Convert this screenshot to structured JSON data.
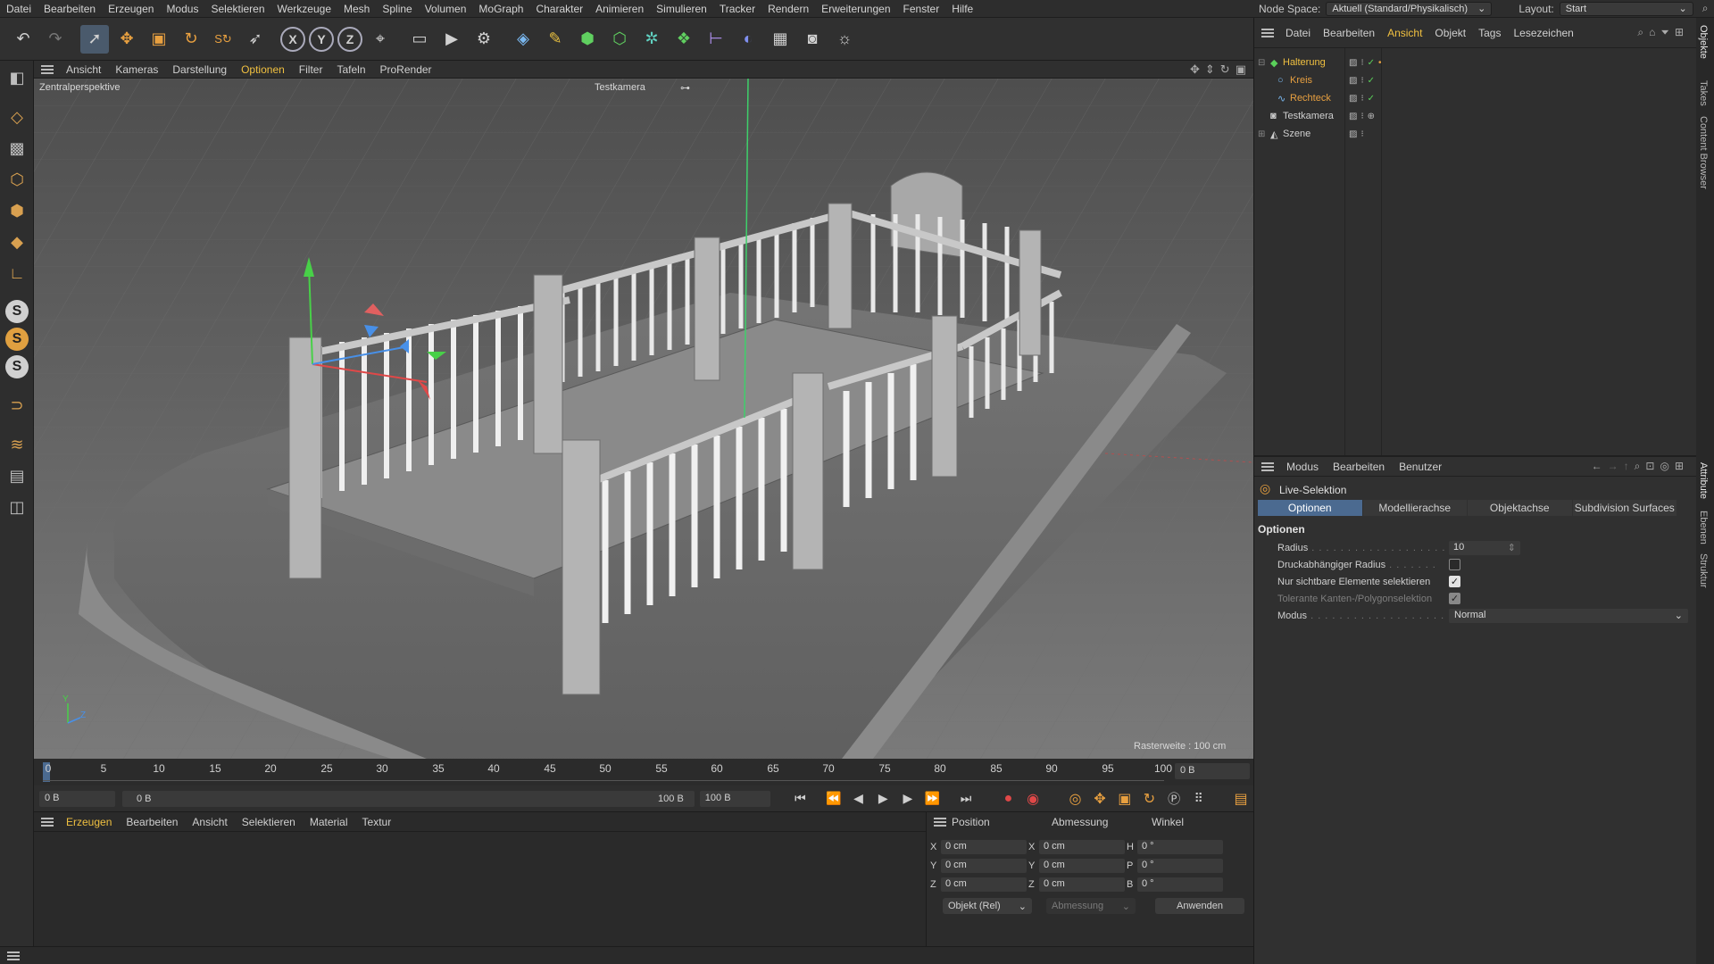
{
  "menubar": {
    "items": [
      "Datei",
      "Bearbeiten",
      "Erzeugen",
      "Modus",
      "Selektieren",
      "Werkzeuge",
      "Mesh",
      "Spline",
      "Volumen",
      "MoGraph",
      "Charakter",
      "Animieren",
      "Simulieren",
      "Tracker",
      "Rendern",
      "Erweiterungen",
      "Fenster",
      "Hilfe"
    ]
  },
  "topright": {
    "node_space_label": "Node Space:",
    "node_space_value": "Aktuell (Standard/Physikalisch)",
    "layout_label": "Layout:",
    "layout_value": "Start"
  },
  "viewport": {
    "menu": [
      "Ansicht",
      "Kameras",
      "Darstellung",
      "Optionen",
      "Filter",
      "Tafeln",
      "ProRender"
    ],
    "active_menu": "Optionen",
    "perspective_label": "Zentralperspektive",
    "camera_label": "Testkamera",
    "grid_label": "Rasterweite : 100 cm",
    "axis_y": "Y",
    "axis_z": "Z"
  },
  "timeline": {
    "ticks": [
      "0",
      "5",
      "10",
      "15",
      "20",
      "25",
      "30",
      "35",
      "40",
      "45",
      "50",
      "55",
      "60",
      "65",
      "70",
      "75",
      "80",
      "85",
      "90",
      "95",
      "100"
    ],
    "current": "0 B",
    "end_field": "0 B"
  },
  "transport": {
    "start_field": "0 B",
    "range_start": "0 B",
    "range_end": "100 B",
    "end_field": "100 B"
  },
  "material_menu": {
    "items": [
      "Erzeugen",
      "Bearbeiten",
      "Ansicht",
      "Selektieren",
      "Material",
      "Textur"
    ],
    "active": "Erzeugen"
  },
  "coords": {
    "headers": [
      "Position",
      "Abmessung",
      "Winkel"
    ],
    "rows": [
      {
        "pos_axis": "X",
        "pos": "0 cm",
        "size_axis": "X",
        "size": "0 cm",
        "rot_axis": "H",
        "rot": "0 °"
      },
      {
        "pos_axis": "Y",
        "pos": "0 cm",
        "size_axis": "Y",
        "size": "0 cm",
        "rot_axis": "P",
        "rot": "0 °"
      },
      {
        "pos_axis": "Z",
        "pos": "0 cm",
        "size_axis": "Z",
        "size": "0 cm",
        "rot_axis": "B",
        "rot": "0 °"
      }
    ],
    "mode_select": "Objekt (Rel)",
    "size_select": "Abmessung",
    "apply_button": "Anwenden"
  },
  "objects": {
    "menu": [
      "Datei",
      "Bearbeiten",
      "Ansicht",
      "Objekt",
      "Tags",
      "Lesezeichen"
    ],
    "active_menu": "Ansicht",
    "items": [
      {
        "name": "Halterung",
        "color": "#f0c040"
      },
      {
        "name": "Kreis",
        "color": "#e8a040"
      },
      {
        "name": "Rechteck",
        "color": "#e8a040"
      },
      {
        "name": "Testkamera",
        "color": "#d0d0d0"
      },
      {
        "name": "Szene",
        "color": "#d0d0d0"
      }
    ]
  },
  "attributes": {
    "menu": [
      "Modus",
      "Bearbeiten",
      "Benutzer"
    ],
    "title": "Live-Selektion",
    "tabs": [
      "Optionen",
      "Modellierachse",
      "Objektachse",
      "Subdivision Surfaces"
    ],
    "active_tab": "Optionen",
    "section": "Optionen",
    "radius_label": "Radius",
    "radius_value": "10",
    "pressure_label": "Druckabhängiger Radius",
    "visible_label": "Nur sichtbare Elemente selektieren",
    "tolerant_label": "Tolerante Kanten-/Polygonselektion",
    "mode_label": "Modus",
    "mode_value": "Normal"
  },
  "vtabs": [
    "Objekte",
    "Takes",
    "Content Browser",
    "Attribute",
    "Ebenen",
    "Struktur"
  ],
  "colors": {
    "accent": "#f0c040",
    "tab_active": "#4b6a90",
    "axis_x": "#e04848",
    "axis_y": "#48d048",
    "axis_z": "#4890e8"
  }
}
